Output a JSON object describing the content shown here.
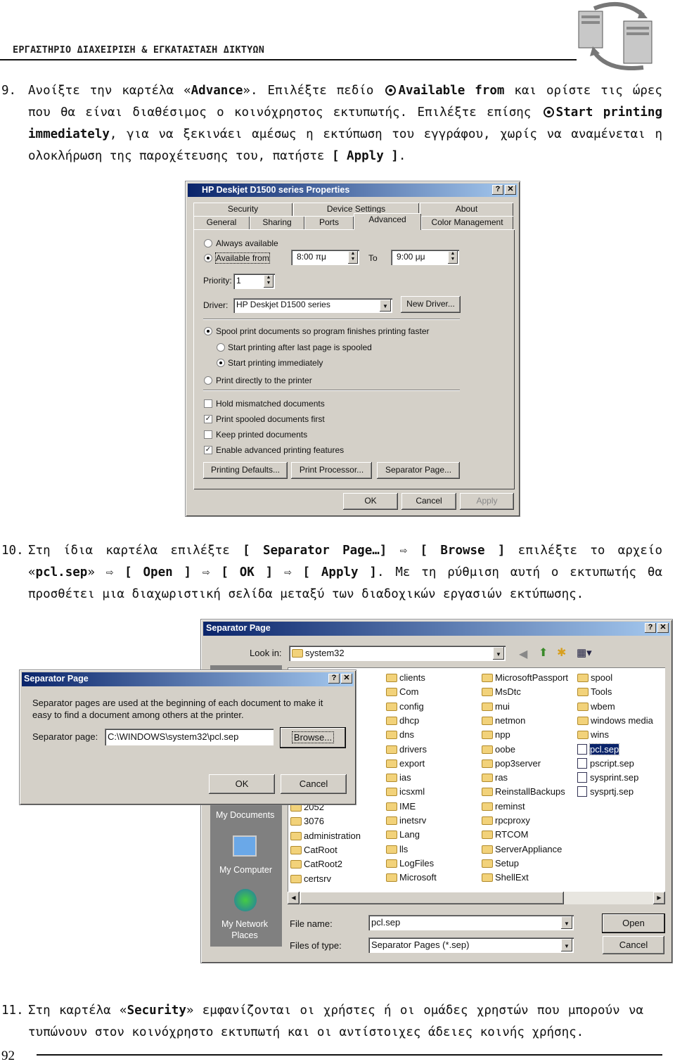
{
  "header": {
    "title": "ΕΡΓΑΣΤΗΡΙΟ ΔΙΑΧΕΙΡΙΣΗ & ΕΓΚΑΤΑΣΤΑΣΗ ΔΙΚΤΥΩΝ",
    "logo": "servers-exchange-icon"
  },
  "paragraphs": [
    {
      "num": "9.",
      "segments": [
        {
          "t": "Ανοίξτε την καρτέλα «"
        },
        {
          "t": "Advance",
          "b": true
        },
        {
          "t": "». Επιλέξτε πεδίο "
        },
        {
          "icon": "radio-selected-icon"
        },
        {
          "t": "Available from",
          "b": true
        },
        {
          "t": " και ορίστε τις ώρες που θα είναι διαθέσιμος ο κοινόχρηστος εκτυπωτής. Επιλέξτε επίσης "
        },
        {
          "icon": "radio-selected-icon"
        },
        {
          "t": "Start printing immedi­ately",
          "b": true
        },
        {
          "t": ", για να ξεκινάει αμέσως η εκτύπωση του εγγράφου, χωρίς να αναμένεται η ολοκλήρω­ση της παροχέτευσης του, πατήστε "
        },
        {
          "t": "[ Apply ]",
          "b": true
        },
        {
          "t": "."
        }
      ]
    },
    {
      "num": "10.",
      "segments": [
        {
          "t": "Στη ίδια καρτέλα επιλέξτε "
        },
        {
          "t": "[ Separator Page…]",
          "b": true
        },
        {
          "t": " ⇨ "
        },
        {
          "t": "[ Browse ]",
          "b": true
        },
        {
          "t": "  επιλέξτε το αρχείο «"
        },
        {
          "t": "pcl.sep",
          "b": true
        },
        {
          "t": "» ⇨ "
        },
        {
          "t": "[ Open ]",
          "b": true
        },
        {
          "t": "  ⇨ "
        },
        {
          "t": "[ OK ]",
          "b": true
        },
        {
          "t": "  ⇨ "
        },
        {
          "t": "[ Apply ]",
          "b": true
        },
        {
          "t": ". Με τη ρύθμιση αυτή ο εκτυπωτής θα προσθέτει μια δια­χωριστική σελίδα μεταξύ των διαδοχικών εργασιών εκτύπωσης."
        }
      ]
    },
    {
      "num": "11.",
      "segments": [
        {
          "t": "Στη καρτέλα «"
        },
        {
          "t": "Security",
          "b": true
        },
        {
          "t": "» εμφανίζονται οι χρήστες ή οι ομάδες χρηστών που μπορούν να τυ­πώνουν στον κοινόχρηστο εκτυπωτή και οι αντίστοιχες άδειες κοινής χρήσης."
        }
      ]
    }
  ],
  "props": {
    "title": "HP Deskjet D1500 series Properties",
    "help": "?",
    "close": "✕",
    "tabs_row1": [
      "Security",
      "Device Settings",
      "About"
    ],
    "tabs_row2": [
      "General",
      "Sharing",
      "Ports",
      "Advanced",
      "Color Management"
    ],
    "always": "Always available",
    "avail_from": "Available from",
    "from_time": "8:00 πμ",
    "to": "To",
    "to_time": "9:00 μμ",
    "priority_label": "Priority:",
    "priority": "1",
    "driver_label": "Driver:",
    "driver": "HP Deskjet D1500 series",
    "new_driver": "New Driver...",
    "spool": "Spool print documents so program finishes printing faster",
    "after_last": "Start printing after last page is spooled",
    "immediately": "Start printing immediately",
    "direct": "Print directly to the printer",
    "hold": "Hold mismatched documents",
    "spooled_first": "Print spooled documents first",
    "keep": "Keep printed documents",
    "advanced": "Enable advanced printing features",
    "printing_defaults": "Printing Defaults...",
    "print_processor": "Print Processor...",
    "separator_page": "Separator Page...",
    "ok": "OK",
    "cancel": "Cancel",
    "apply": "Apply"
  },
  "open_dialog": {
    "title": "Separator Page",
    "help": "?",
    "close": "✕",
    "look_in_label": "Look in:",
    "look_in": "system32",
    "places": [
      "My Documents",
      "My Computer",
      "My Network Places"
    ],
    "col1": [
      "2052",
      "3076",
      "administration",
      "CatRoot",
      "CatRoot2",
      "certsrv"
    ],
    "col2": [
      "clients",
      "Com",
      "config",
      "dhcp",
      "dns",
      "drivers",
      "export",
      "ias",
      "icsxml",
      "IME",
      "inetsrv",
      "Lang",
      "lls",
      "LogFiles",
      "Microsoft"
    ],
    "col3": [
      "MicrosoftPassport",
      "MsDtc",
      "mui",
      "netmon",
      "npp",
      "oobe",
      "pop3server",
      "ras",
      "ReinstallBackups",
      "reminst",
      "rpcproxy",
      "RTCOM",
      "ServerAppliance",
      "Setup",
      "ShellExt"
    ],
    "col4_folders": [
      "spool",
      "Tools",
      "wbem",
      "windows media",
      "wins"
    ],
    "col4_files": [
      "pcl.sep",
      "pscript.sep",
      "sysprint.sep",
      "sysprtj.sep"
    ],
    "selected": "pcl.sep",
    "file_name_label": "File name:",
    "file_name": "pcl.sep",
    "type_label": "Files of type:",
    "file_type": "Separator Pages (*.sep)",
    "open": "Open",
    "cancel": "Cancel"
  },
  "sep_dialog": {
    "title": "Separator Page",
    "help": "?",
    "close": "✕",
    "description": "Separator pages are used at the beginning of each document to make it easy to find a document among others at the printer.",
    "page_label": "Separator page:",
    "page_value": "C:\\WINDOWS\\system32\\pcl.sep",
    "browse": "Browse...",
    "ok": "OK",
    "cancel": "Cancel"
  },
  "footer": {
    "page_number": "92"
  }
}
